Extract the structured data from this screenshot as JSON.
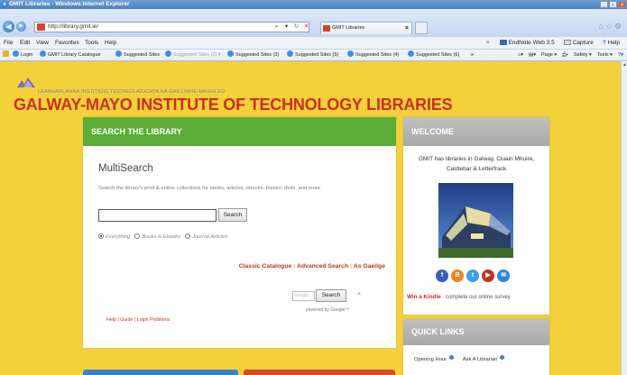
{
  "window": {
    "title": "GMIT Libraries - Windows Internet Explorer"
  },
  "addressbar": {
    "url": "http://library.gmit.ie/"
  },
  "tab": {
    "label": "GMIT Libraries"
  },
  "menu": {
    "items": [
      "File",
      "Edit",
      "View",
      "Favorites",
      "Tools",
      "Help"
    ],
    "right": [
      "EndNote Web 3.5",
      "Capture",
      "Help"
    ]
  },
  "favorites": {
    "items": [
      {
        "label": "Login"
      },
      {
        "label": "GMIT Library Catalogue"
      },
      {
        "label": "Suggested Sites"
      },
      {
        "label": "Suggested Sites (2)"
      },
      {
        "label": "Suggested Sites (3)"
      },
      {
        "label": "Suggested Sites (5)"
      },
      {
        "label": "Suggested Sites (4)"
      },
      {
        "label": "Suggested Sites (6)"
      }
    ],
    "tools": [
      "Page",
      "Safety",
      "Tools"
    ]
  },
  "header": {
    "irish_name": "LEABHARLANNA INSTITIÚID TEICNEOLAÍOCHTA NA GAILLIMHE-MAIGH EO",
    "title": "GALWAY-MAYO INSTITUTE OF TECHNOLOGY LIBRARIES"
  },
  "search": {
    "heading": "SEARCH THE LIBRARY",
    "title": "MultiSearch",
    "description": "Search the library's print & online collections for books, articles, ebooks, theses, dvds, and more",
    "input_value": "",
    "button": "Search",
    "options": [
      "Everything",
      "Books & Ebooks",
      "Journal Articles"
    ],
    "selected_option": "Everything",
    "links": [
      "Classic Catalogue",
      "Advanced Search",
      "As Gaeilge"
    ],
    "google_placeholder": "Google",
    "google_button": "Search",
    "google_close": "×",
    "powered_by": "powered by Google™",
    "help_links": "Help | Guide | Login Problems"
  },
  "welcome": {
    "heading": "WELCOME",
    "text": "GMIT has libraries in Galway, Cluain Mhuire, Castlebar & Letterfrack",
    "kindle_bold": "Win a Kindle",
    "kindle_rest": " - complete our online survey"
  },
  "quick_links": {
    "heading": "QUICK LINKS",
    "items": [
      "Opening Hour",
      "Ask A Librarian"
    ]
  },
  "colors": {
    "page_bg": "#f4d03a",
    "brand_red": "#c8321e",
    "search_green": "#5cac39",
    "panel_grey": "#b5b5b5"
  }
}
